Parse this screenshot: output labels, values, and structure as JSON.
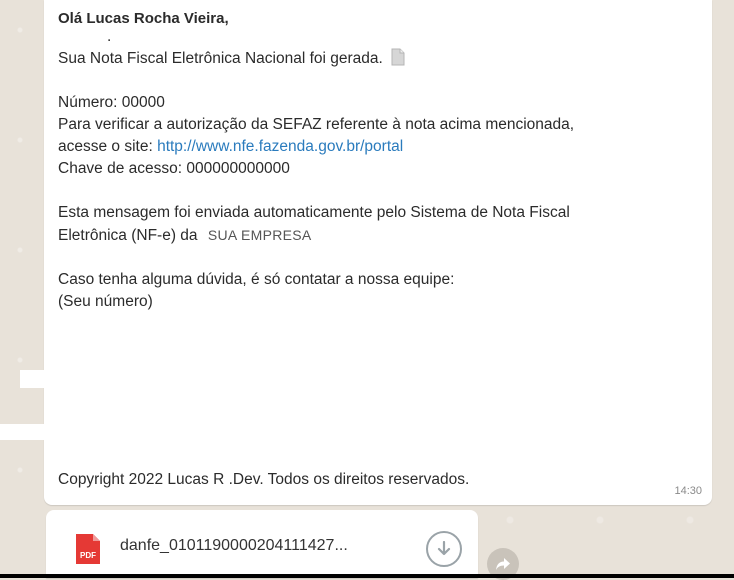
{
  "message": {
    "greeting": "Olá Lucas Rocha Vieira,",
    "dot": ".",
    "line_generated": "Sua Nota Fiscal Eletrônica Nacional foi gerada.",
    "number": "Número: 00000",
    "verify_text": "Para verificar a autorização da SEFAZ referente à nota acima mencionada,",
    "access_prefix": "acesse o site: ",
    "portal_url": "http://www.nfe.fazenda.gov.br/portal",
    "access_key": "Chave de acesso: 000000000000",
    "auto_msg_1": "Esta mensagem foi enviada automaticamente pelo Sistema de Nota Fiscal",
    "auto_msg_2": "Eletrônica (NF-e) da ",
    "company": "SUA EMPRESA",
    "contact": "Caso tenha alguma dúvida, é só contatar a nossa equipe:",
    "phone": "(Seu número)",
    "copyright": "Copyright 2022 Lucas R .Dev. Todos os direitos reservados.",
    "time": "14:30"
  },
  "attachment": {
    "icon_label": "PDF",
    "filename": "danfe_010119000020411142​7...",
    "icon": "download-icon"
  },
  "forward": {
    "icon": "forward-icon"
  },
  "colors": {
    "link": "#2a7bbd",
    "pdf": "#e53935"
  }
}
